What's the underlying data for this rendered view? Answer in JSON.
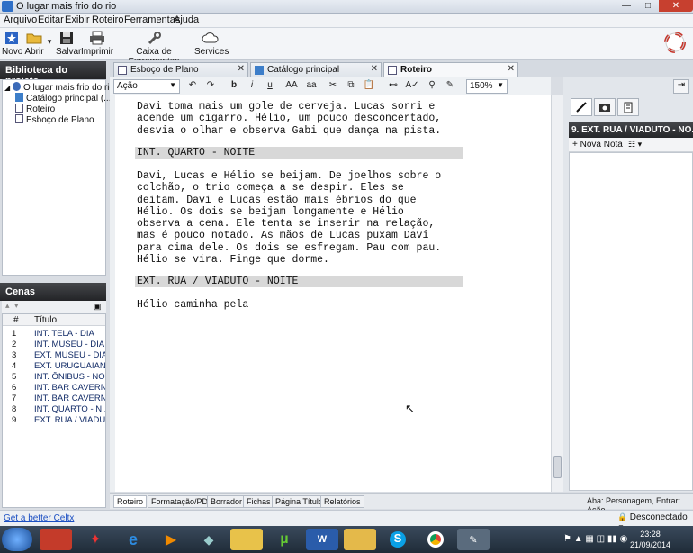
{
  "window": {
    "title": "O lugar mais frio do rio"
  },
  "menu": [
    "Arquivo",
    "Editar",
    "Exibir",
    "Roteiro",
    "Ferramentas",
    "Ajuda"
  ],
  "toolbar": {
    "novo": "Novo",
    "abrir": "Abrir",
    "salvar": "Salvar",
    "imprimir": "Imprimir",
    "caixa": "Caixa de Ferramentas",
    "services": "Services"
  },
  "library": {
    "title": "Biblioteca do projeto",
    "root": "O lugar mais frio do rio",
    "items": [
      "Catálogo principal (...",
      "Roteiro",
      "Esboço de Plano"
    ]
  },
  "scenes": {
    "title": "Cenas",
    "col_num": "#",
    "col_title": "Título",
    "rows": [
      {
        "n": "1",
        "t": "INT. TELA - DIA"
      },
      {
        "n": "2",
        "t": "INT. MUSEU - DIA"
      },
      {
        "n": "3",
        "t": "EXT. MUSEU - DIA"
      },
      {
        "n": "4",
        "t": "EXT. URUGUAIAN..."
      },
      {
        "n": "5",
        "t": "INT. ÔNIBUS - NO..."
      },
      {
        "n": "6",
        "t": "INT. BAR CAVERN..."
      },
      {
        "n": "7",
        "t": "INT. BAR CAVERN..."
      },
      {
        "n": "8",
        "t": "INT. QUARTO - N..."
      },
      {
        "n": "9",
        "t": "EXT. RUA / VIADU..."
      }
    ]
  },
  "link": "Get a better Celtx",
  "tabs": [
    "Esboço de Plano",
    "Catálogo principal",
    "Roteiro"
  ],
  "editor_toolbar": {
    "style": "Ação",
    "bold": "b",
    "italic": "i",
    "underline": "u",
    "upper": "AA",
    "lower": "aa",
    "zoom": "150%"
  },
  "script": {
    "block1": "Davi toma mais um gole de cerveja. Lucas sorri e\nacende um cigarro. Hélio, um pouco desconcertado,\ndesvia o olhar e observa Gabi que dança na pista.",
    "heading1": "INT. QUARTO - NOITE",
    "block2": "Davi, Lucas e Hélio se beijam. De joelhos sobre o\ncolchão, o trio começa a se despir. Eles se\ndeitam. Davi e Lucas estão mais ébrios do que\nHélio. Os dois se beijam longamente e Hélio\nobserva a cena. Ele tenta se inserir na relação,\nmas é pouco notado. As mãos de Lucas puxam Davi\npara cima dele. Os dois se esfregam. Pau com pau.\nHélio se vira. Finge que dorme.",
    "heading2": "EXT. RUA / VIADUTO - NOITE",
    "block3": "Hélio caminha pela"
  },
  "right_panel": {
    "title": "9. EXT. RUA / VIADUTO - NO...",
    "new_note": "Nova Nota"
  },
  "bottom_tabs": [
    "Roteiro",
    "Formatação/PDF",
    "Borrador",
    "Fichas",
    "Página Título",
    "Relatórios"
  ],
  "hint": "Aba: Personagem, Entrar: Ação",
  "status": "Desconectado",
  "clock": {
    "time": "23:28",
    "date": "21/09/2014"
  }
}
